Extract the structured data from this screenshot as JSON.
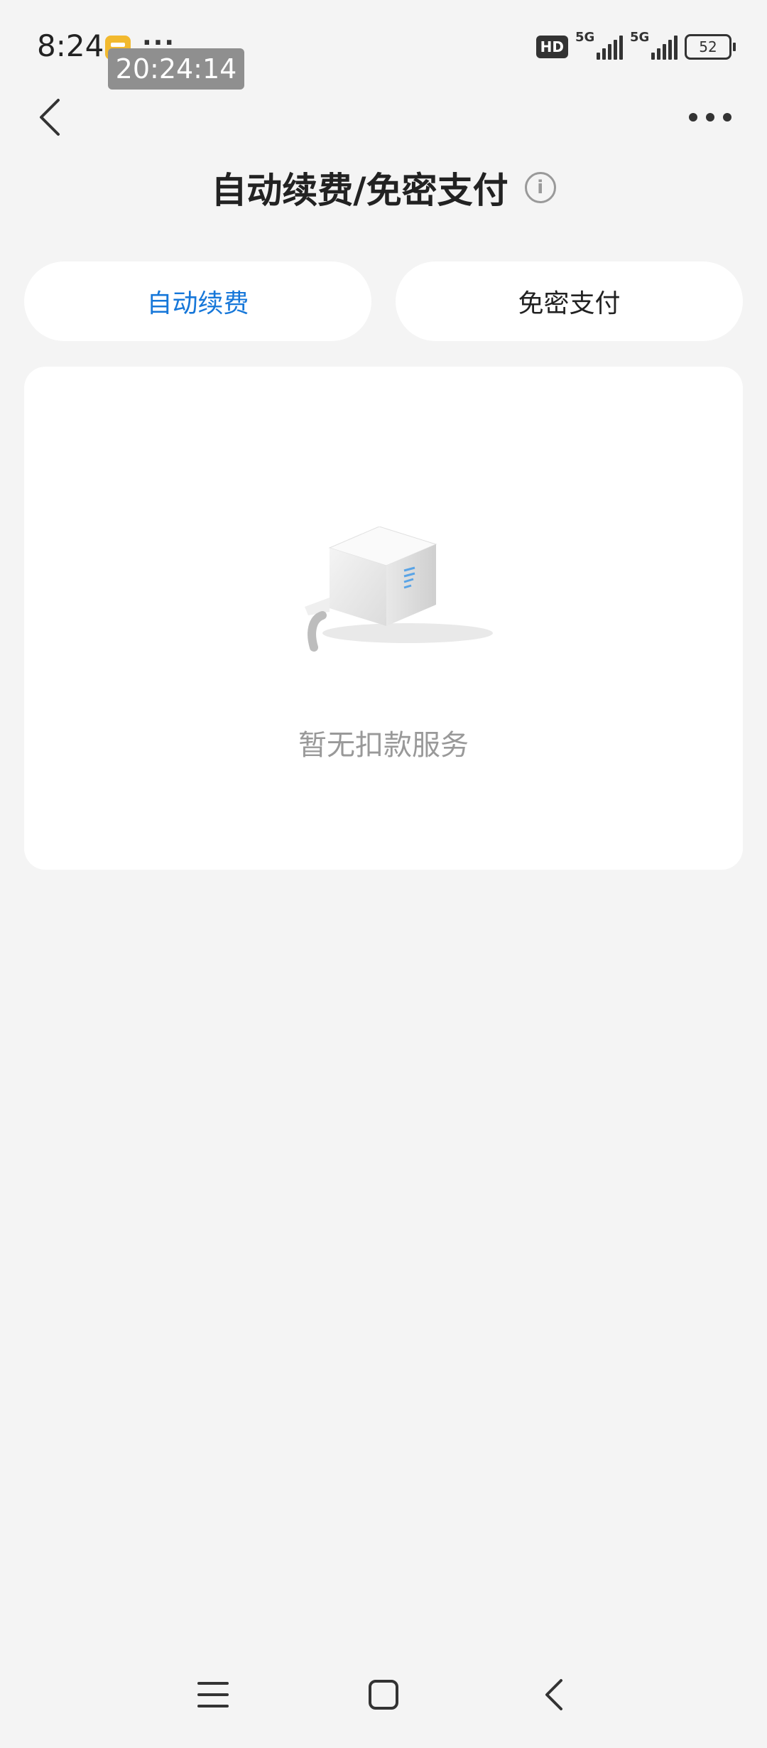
{
  "status_bar": {
    "time": "8:24",
    "timestamp_overlay": "20:24:14",
    "more_notifications": "···",
    "hd_label": "HD",
    "network_1": "5G",
    "network_2": "5G",
    "battery": "52"
  },
  "header": {
    "title": "自动续费/免密支付",
    "info_glyph": "i"
  },
  "tabs": [
    {
      "label": "自动续费",
      "active": true
    },
    {
      "label": "免密支付",
      "active": false
    }
  ],
  "empty_state": {
    "message": "暂无扣款服务"
  },
  "colors": {
    "background": "#f4f4f4",
    "card": "#ffffff",
    "accent_blue": "#1677d9",
    "muted_text": "#999999"
  },
  "icons": [
    "back-arrow-icon",
    "more-dots-icon",
    "info-icon",
    "empty-box-icon",
    "menu-icon",
    "home-icon",
    "nav-back-icon"
  ]
}
